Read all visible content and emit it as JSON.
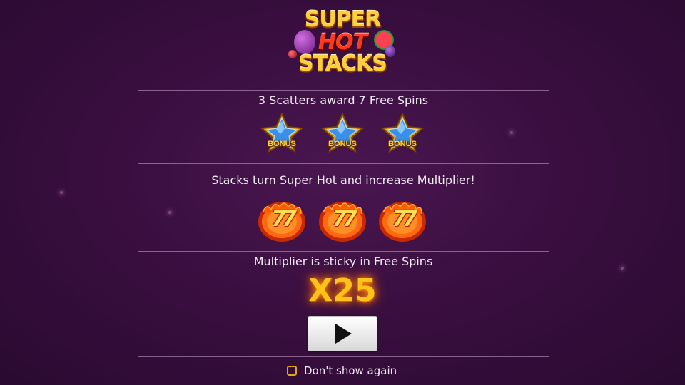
{
  "logo": {
    "line1": "SUPER",
    "line2": "HOT",
    "line3": "STACKS"
  },
  "sections": [
    {
      "text": "3 Scatters award 7 Free Spins",
      "symbols": [
        {
          "icon": "bonus-star-icon",
          "label": "BONUS"
        },
        {
          "icon": "bonus-star-icon",
          "label": "BONUS"
        },
        {
          "icon": "bonus-star-icon",
          "label": "BONUS"
        }
      ]
    },
    {
      "text": "Stacks turn Super Hot and increase Multiplier!",
      "symbols": [
        {
          "icon": "flaming-seven-icon",
          "label": "77"
        },
        {
          "icon": "flaming-seven-icon",
          "label": "77"
        },
        {
          "icon": "flaming-seven-icon",
          "label": "77"
        }
      ]
    },
    {
      "text": "Multiplier is sticky in Free Spins",
      "multiplier": "X25"
    }
  ],
  "play_button": {
    "icon": "play-icon"
  },
  "dont_show": {
    "label": "Don't show again",
    "checked": false
  },
  "colors": {
    "background": "#3a0f40",
    "gold": "#ffc41a",
    "checkbox_border": "#e2a51a",
    "divider": "#c8aad2"
  }
}
